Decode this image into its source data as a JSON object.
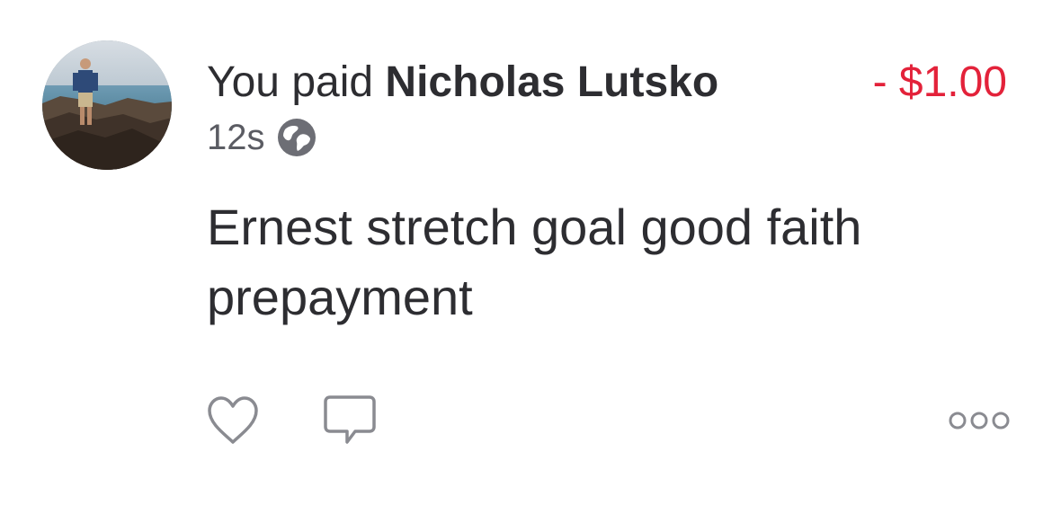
{
  "story": {
    "prefix": "You paid ",
    "recipient": "Nicholas Lutsko",
    "amount": "- $1.00",
    "time": "12s",
    "audience_icon": "globe-icon",
    "message": "Ernest stretch goal good faith prepayment",
    "actions": {
      "like_icon": "heart-icon",
      "comment_icon": "comment-icon",
      "more_icon": "more-icon"
    }
  },
  "colors": {
    "amount_negative": "#e3223a",
    "text": "#2d2d31",
    "icon_gray": "#8a8b91"
  }
}
